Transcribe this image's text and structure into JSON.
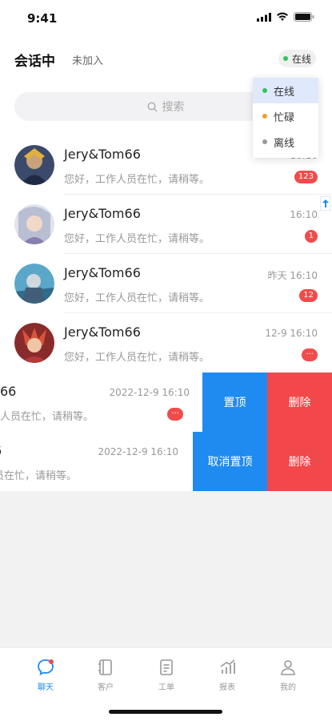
{
  "status_bar": {
    "time": "9:41"
  },
  "header": {
    "tab_active": "会话中",
    "tab_inactive": "未加入",
    "status_chip": {
      "label": "在线",
      "color": "#2ec55b"
    }
  },
  "status_menu": {
    "options": [
      {
        "label": "在线",
        "color": "#2ec55b",
        "selected": true
      },
      {
        "label": "忙碌",
        "color": "#f59a23",
        "selected": false
      },
      {
        "label": "离线",
        "color": "#999999",
        "selected": false
      }
    ]
  },
  "search": {
    "placeholder": "搜索"
  },
  "conversations": [
    {
      "name": "Jery&Tom66",
      "preview": "您好，工作人员在忙，请稍等。",
      "time": "16:10",
      "badge": "123"
    },
    {
      "name": "Jery&Tom66",
      "preview": "您好，工作人员在忙，请稍等。",
      "time": "16:10",
      "badge": "1"
    },
    {
      "name": "Jery&Tom66",
      "preview": "您好，工作人员在忙，请稍等。",
      "time": "昨天  16:10",
      "badge": "12"
    },
    {
      "name": "Jery&Tom66",
      "preview": "您好，工作人员在忙，请稍等。",
      "time": "12-9  16:10",
      "badge": "···"
    },
    {
      "name": "66",
      "preview": "人员在忙，请稍等。",
      "time": "2022-12-9  16:10",
      "badge": "···",
      "action_primary": "置顶",
      "action_delete": "删除"
    },
    {
      "name": "6",
      "preview": "员在忙，请稍等。",
      "time": "2022-12-9  16:10",
      "action_primary": "取消置顶",
      "action_delete": "删除"
    }
  ],
  "tabbar": {
    "items": [
      {
        "label": "聊天",
        "icon": "chat-icon",
        "active": true
      },
      {
        "label": "客户",
        "icon": "contacts-icon",
        "active": false
      },
      {
        "label": "工单",
        "icon": "ticket-icon",
        "active": false
      },
      {
        "label": "报表",
        "icon": "report-icon",
        "active": false
      },
      {
        "label": "我的",
        "icon": "profile-icon",
        "active": false
      }
    ]
  },
  "colors": {
    "accent": "#1f8bf0",
    "danger": "#f2474b",
    "badge": "#f24b4b"
  }
}
